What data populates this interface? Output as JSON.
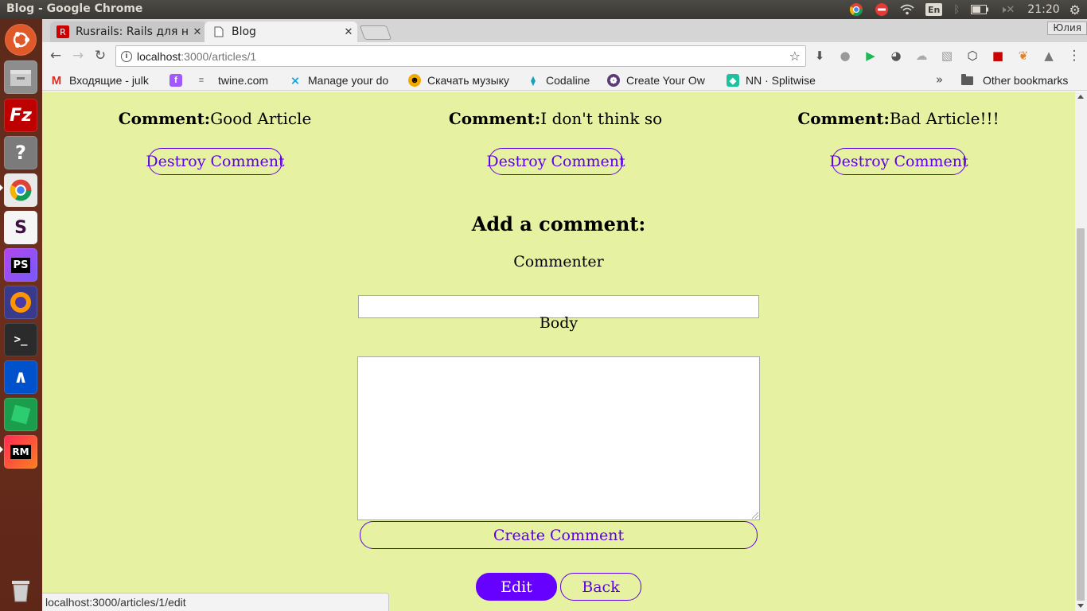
{
  "os_panel": {
    "window_title": "Blog - Google Chrome",
    "lang": "En",
    "clock": "21:20"
  },
  "launcher": {
    "items": [
      "ubuntu-dash",
      "files",
      "filezilla",
      "help",
      "chrome",
      "slack",
      "phpstorm",
      "firefox",
      "terminal",
      "bitbucket",
      "app-green",
      "rubymine",
      "trash"
    ]
  },
  "browser": {
    "tabs": [
      {
        "label": "Rusrails: Rails для н",
        "active": false
      },
      {
        "label": "Blog",
        "active": true
      }
    ],
    "user_badge": "Юлия",
    "address": {
      "host": "localhost",
      "path": ":3000/articles/1"
    },
    "bookmarks": [
      {
        "label": "Входящие - julk",
        "icon": "gmail-icon",
        "color": "#d93025"
      },
      {
        "label": "",
        "icon": "figma-icon",
        "color": "#a259ff"
      },
      {
        "label": "twine.com",
        "icon": "twine-icon",
        "color": "#777777"
      },
      {
        "label": "Manage your do",
        "icon": "vector-icon",
        "color": "#1aa3d9"
      },
      {
        "label": "Скачать музыку",
        "icon": "music-icon",
        "color": "#f2a900"
      },
      {
        "label": "Codaline",
        "icon": "codaline-icon",
        "color": "#17a2b8"
      },
      {
        "label": "Create Your Ow",
        "icon": "create-icon",
        "color": "#5b3a7a"
      },
      {
        "label": "NN · Splitwise",
        "icon": "splitwise-icon",
        "color": "#1cc29f"
      }
    ],
    "other_bookmarks": "Other bookmarks",
    "status_url": "localhost:3000/articles/1/edit"
  },
  "page": {
    "comments": [
      {
        "prefix": "Comment:",
        "text": "Good Article",
        "destroy_label": "Destroy Comment"
      },
      {
        "prefix": "Comment:",
        "text": "I don't think so",
        "destroy_label": "Destroy Comment"
      },
      {
        "prefix": "Comment:",
        "text": "Bad Article!!!",
        "destroy_label": "Destroy Comment"
      }
    ],
    "form": {
      "heading": "Add a comment:",
      "commenter_label": "Commenter",
      "commenter_value": "",
      "body_label": "Body",
      "body_value": "",
      "submit_label": "Create Comment"
    },
    "edit_label": "Edit",
    "back_label": "Back"
  },
  "colors": {
    "page_background": "#e6f2a2",
    "accent": "#5c00e6",
    "edit_button": "#6600ff"
  }
}
